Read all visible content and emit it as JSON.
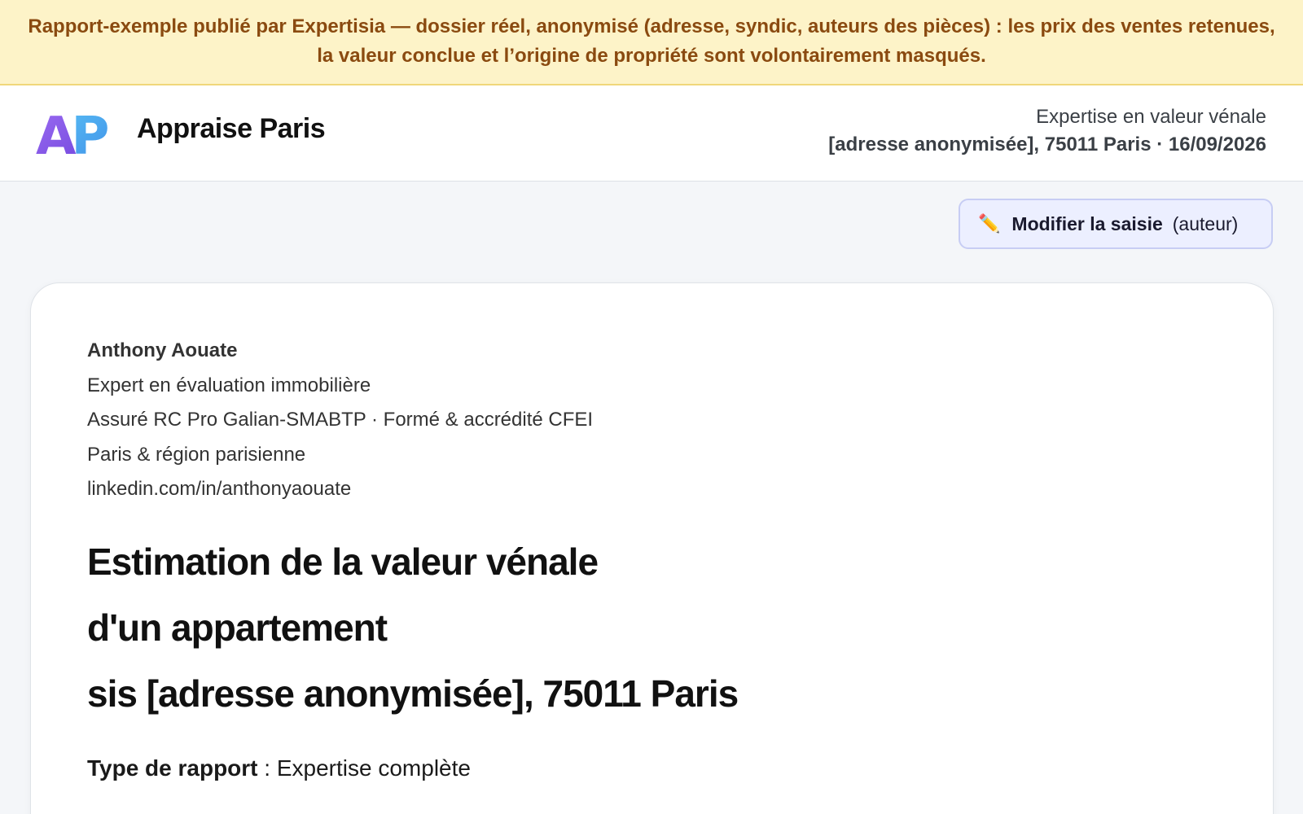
{
  "banner": {
    "text": "Rapport-exemple publié par Expertisia — dossier réel, anonymisé (adresse, syndic, auteurs des pièces) : les prix des ventes retenues, la valeur conclue et l’origine de propriété sont volontairement masqués."
  },
  "header": {
    "logo_text": "AP",
    "brand": "Appraise Paris",
    "report_type": "Expertise en valeur vénale",
    "report_address_date": "[adresse anonymisée], 75011 Paris · 16/09/2026"
  },
  "toolbar": {
    "edit_label": "Modifier la saisie",
    "edit_suffix": "(auteur)",
    "edit_icon": "pencil-icon"
  },
  "author": {
    "name": "Anthony Aouate",
    "title": "Expert en évaluation immobilière",
    "insurance": "Assuré RC Pro Galian-SMABTP · Formé & accrédité CFEI",
    "region": "Paris & région parisienne",
    "linkedin": "linkedin.com/in/anthonyaouate"
  },
  "document": {
    "title_line1": "Estimation de la valeur vénale",
    "title_line2": "d'un appartement",
    "title_line3": "sis [adresse anonymisée], 75011 Paris",
    "type_key": "Type de rapport",
    "type_sep": " : ",
    "type_value": "Expertise complète"
  },
  "colors": {
    "banner_bg": "#fdf3c8",
    "banner_text": "#8a4a10",
    "logo_a": "#7b4fe0",
    "logo_p": "#4fb6f0",
    "edit_bg": "#ecefff"
  }
}
